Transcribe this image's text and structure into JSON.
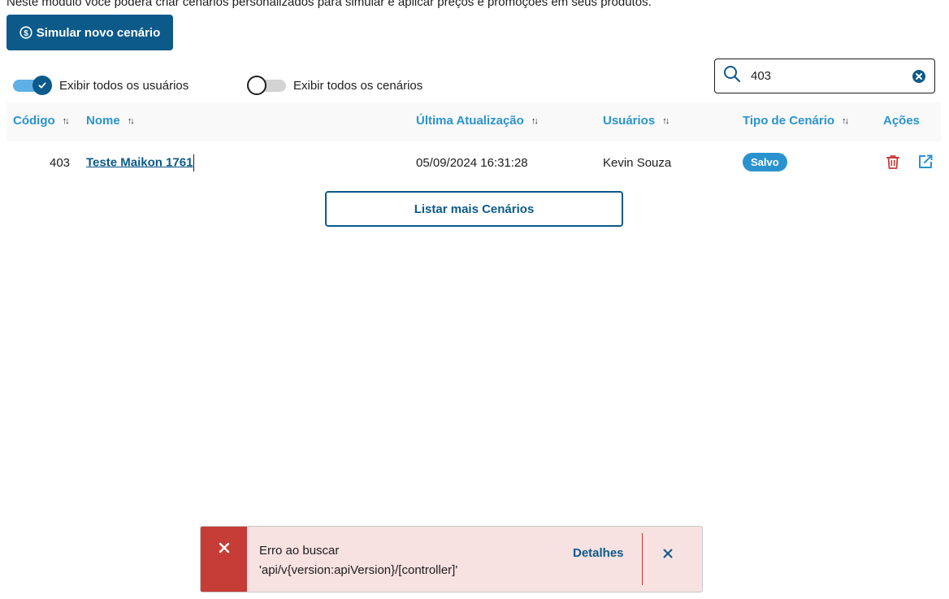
{
  "intro_text": "Neste módulo você poderá criar cenários personalizados para simular e aplicar preços e promoções em seus produtos.",
  "primary_button": {
    "label": "Simular novo cenário",
    "icon": "dollar-circle-icon"
  },
  "toggles": [
    {
      "label": "Exibir todos os usuários",
      "state": "on"
    },
    {
      "label": "Exibir todos os cenários",
      "state": "off"
    }
  ],
  "search": {
    "value": "403",
    "icon": "search-icon",
    "clear_icon": "clear-circle-icon"
  },
  "table": {
    "columns": [
      "Código",
      "Nome",
      "Última Atualização",
      "Usuários",
      "Tipo de Cenário",
      "Ações"
    ],
    "rows": [
      {
        "codigo": "403",
        "nome": "Teste Maikon 1761",
        "ultima_atualizacao": "05/09/2024 16:31:28",
        "usuario": "Kevin Souza",
        "tipo": "Salvo"
      }
    ]
  },
  "list_more_button": "Listar mais Cenários",
  "toast": {
    "line1": "Erro ao buscar",
    "line2": "'api/v{version:apiVersion}/[controller]'",
    "details": "Detalhes"
  },
  "colors": {
    "primary": "#0b5a8a",
    "accent": "#2a93cf",
    "danger": "#c63c36",
    "toast_bg": "#f7e1e1"
  }
}
